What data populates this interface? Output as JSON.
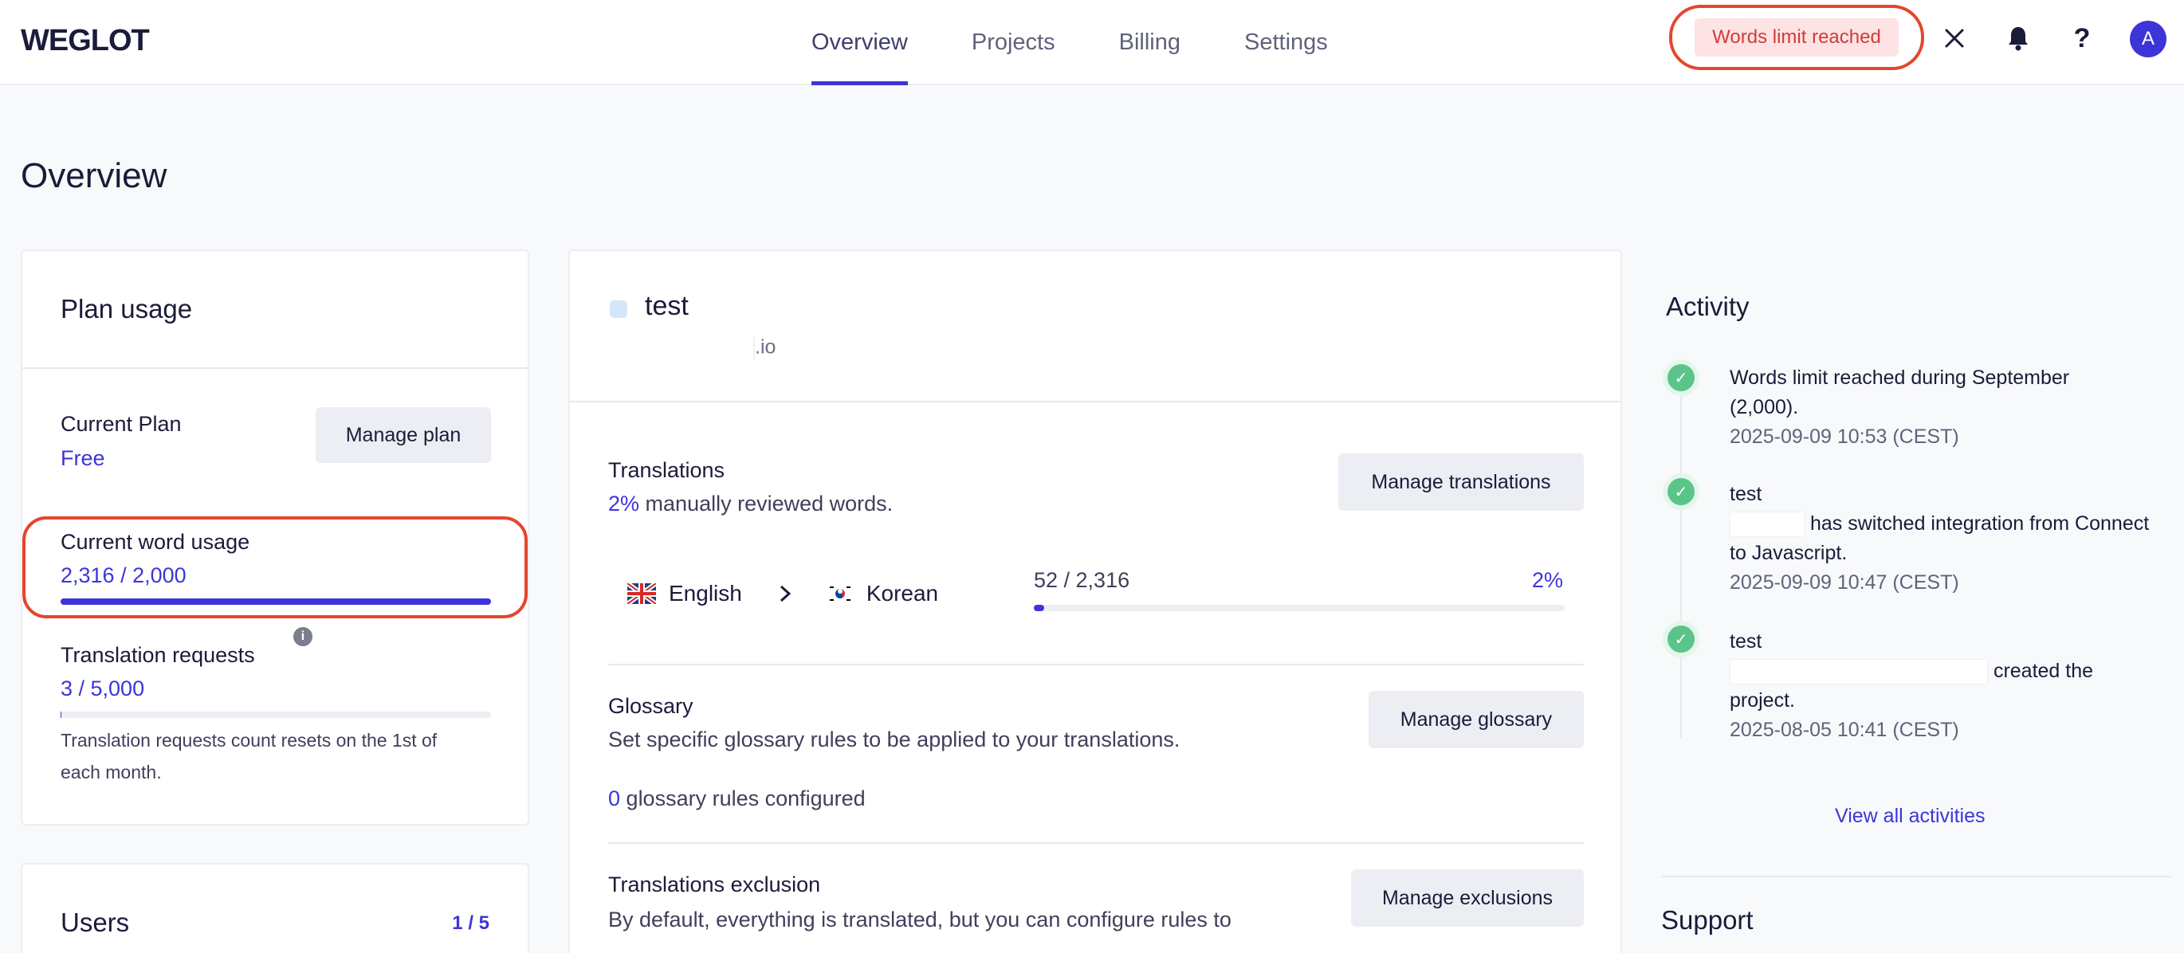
{
  "brand": {
    "logo_text": "WEGLOT"
  },
  "nav": {
    "tabs": [
      {
        "label": "Overview",
        "active": true
      },
      {
        "label": "Projects",
        "active": false
      },
      {
        "label": "Billing",
        "active": false
      },
      {
        "label": "Settings",
        "active": false
      }
    ]
  },
  "header": {
    "alert_badge": "Words limit reached",
    "close_icon": "close-icon",
    "bell_icon": "bell-icon",
    "help_icon": "help-icon",
    "avatar_initial": "A"
  },
  "page": {
    "title": "Overview"
  },
  "plan_usage": {
    "title": "Plan usage",
    "current_plan_label": "Current Plan",
    "current_plan_value": "Free",
    "manage_plan_button": "Manage plan",
    "word_usage_label": "Current word usage",
    "word_usage_value": "2,316 / 2,000",
    "word_usage_fraction": 1.0,
    "translation_requests_label": "Translation requests",
    "translation_requests_value": "3 / 5,000",
    "translation_requests_fraction": 0.0006,
    "translation_requests_note_line1": "Translation requests count resets on the 1st of",
    "translation_requests_note_line2": "each month."
  },
  "users": {
    "title": "Users",
    "count": "1 / 5"
  },
  "project": {
    "name": "test",
    "domain_suffix": ".io",
    "translations": {
      "title": "Translations",
      "reviewed_percent": "2%",
      "reviewed_text": "manually reviewed words.",
      "manage_button": "Manage translations",
      "source_language": "English",
      "target_language": "Korean",
      "word_progress": "52 / 2,316",
      "progress_percent": "2%",
      "progress_fraction": 0.02
    },
    "glossary": {
      "title": "Glossary",
      "description": "Set specific glossary rules to be applied to your translations.",
      "manage_button": "Manage glossary",
      "rules_count": "0",
      "rules_text": "glossary rules configured"
    },
    "exclusion": {
      "title": "Translations exclusion",
      "description": "By default, everything is translated, but you can configure rules to",
      "manage_button": "Manage exclusions"
    }
  },
  "activity": {
    "title": "Activity",
    "items": [
      {
        "line1": "Words limit reached during September",
        "line2": "(2,000).",
        "date": "2025-09-09 10:53 (CEST)"
      },
      {
        "line1": "test",
        "line2": "has switched integration from Connect",
        "line3": "to Javascript.",
        "date": "2025-09-09 10:47 (CEST)"
      },
      {
        "line1": "test",
        "line2": "created the",
        "line3": "project.",
        "date": "2025-08-05 10:41 (CEST)"
      }
    ],
    "view_all_link": "View all activities"
  },
  "support": {
    "title": "Support"
  },
  "colors": {
    "accent": "#3d35d8",
    "alert_ring": "#e5452d",
    "success": "#5bc48a"
  }
}
